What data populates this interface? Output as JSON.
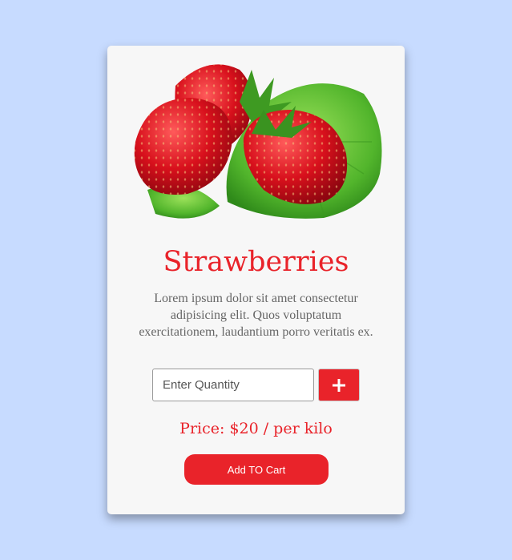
{
  "product": {
    "name": "Strawberries",
    "description": "Lorem ipsum dolor sit amet consectetur adipisicing elit. Quos voluptatum exercitationem, laudantium porro veritatis ex.",
    "image_icon": "strawberries-image",
    "quantity": {
      "value": "",
      "placeholder": "Enter Quantity"
    },
    "add_button_icon": "plus-icon",
    "price_text": "Price: $20 / per kilo",
    "cart_button_label": "Add TO Cart"
  },
  "colors": {
    "background": "#c7dbff",
    "card": "#f7f7f7",
    "accent": "#e9232a",
    "text_muted": "#666666"
  }
}
